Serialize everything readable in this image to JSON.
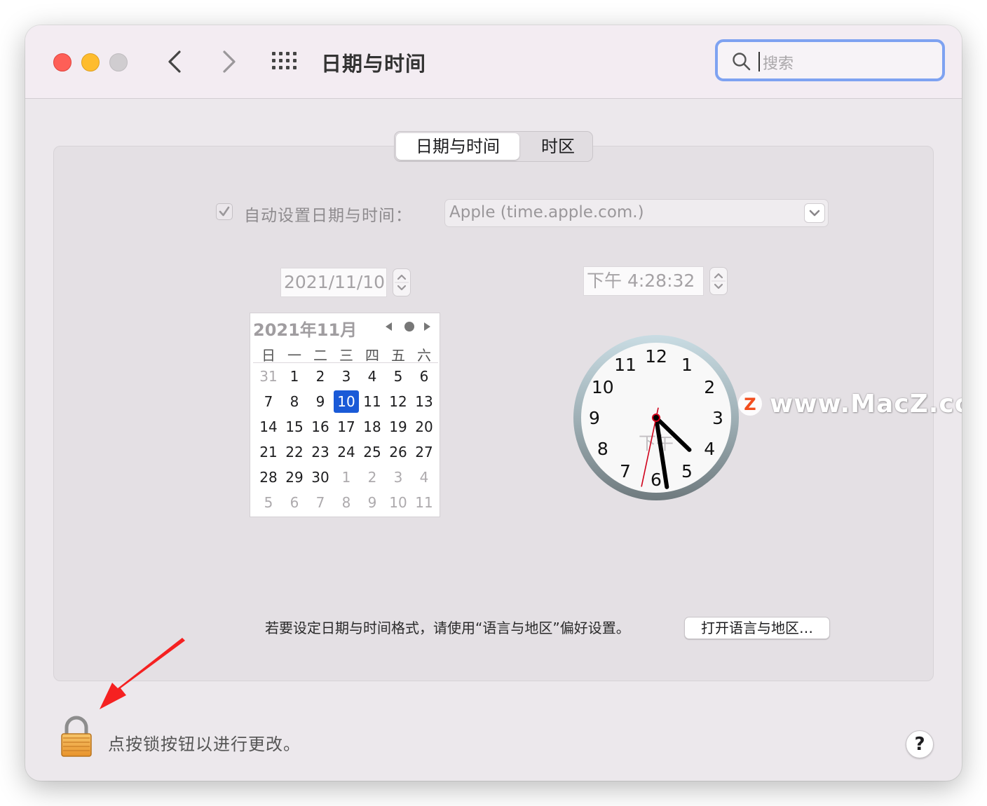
{
  "window": {
    "title": "日期与时间"
  },
  "search": {
    "placeholder": "搜索"
  },
  "tabs": [
    {
      "label": "日期与时间",
      "active": true
    },
    {
      "label": "时区",
      "active": false
    }
  ],
  "auto": {
    "label": "自动设置日期与时间：",
    "checked": true,
    "server": "Apple (time.apple.com.)"
  },
  "date_field": {
    "value": "2021/11/10"
  },
  "time_field": {
    "value": "下午  4:28:32"
  },
  "calendar": {
    "title": "2021年11月",
    "weekdays": [
      "日",
      "一",
      "二",
      "三",
      "四",
      "五",
      "六"
    ],
    "weeks": [
      [
        "31",
        "1",
        "2",
        "3",
        "4",
        "5",
        "6"
      ],
      [
        "7",
        "8",
        "9",
        "10",
        "11",
        "12",
        "13"
      ],
      [
        "14",
        "15",
        "16",
        "17",
        "18",
        "19",
        "20"
      ],
      [
        "21",
        "22",
        "23",
        "24",
        "25",
        "26",
        "27"
      ],
      [
        "28",
        "29",
        "30",
        "1",
        "2",
        "3",
        "4"
      ],
      [
        "5",
        "6",
        "7",
        "8",
        "9",
        "10",
        "11"
      ]
    ],
    "selected": "10"
  },
  "clock": {
    "numbers": [
      "12",
      "1",
      "2",
      "3",
      "4",
      "5",
      "6",
      "7",
      "8",
      "9",
      "10",
      "11"
    ],
    "ampm": "下午",
    "hour": 4,
    "minute": 28,
    "second": 32
  },
  "watermark": {
    "text": "www.MacZ.com",
    "logo": "Z"
  },
  "format": {
    "text": "若要设定日期与时间格式，请使用“语言与地区”偏好设置。",
    "button": "打开语言与地区…"
  },
  "lock": {
    "text": "点按锁按钮以进行更改。"
  },
  "help": {
    "label": "?"
  },
  "colors": {
    "accent": "#1a5ad7",
    "search_border": "#7ea2f1",
    "arrow": "#f52121",
    "second_hand": "#d0021b"
  },
  "icons": [
    "chevron-left-icon",
    "chevron-right-icon",
    "grid-icon",
    "search-icon",
    "checkmark-icon",
    "chevron-down-icon",
    "stepper-icon",
    "lock-icon",
    "arrow-icon"
  ]
}
